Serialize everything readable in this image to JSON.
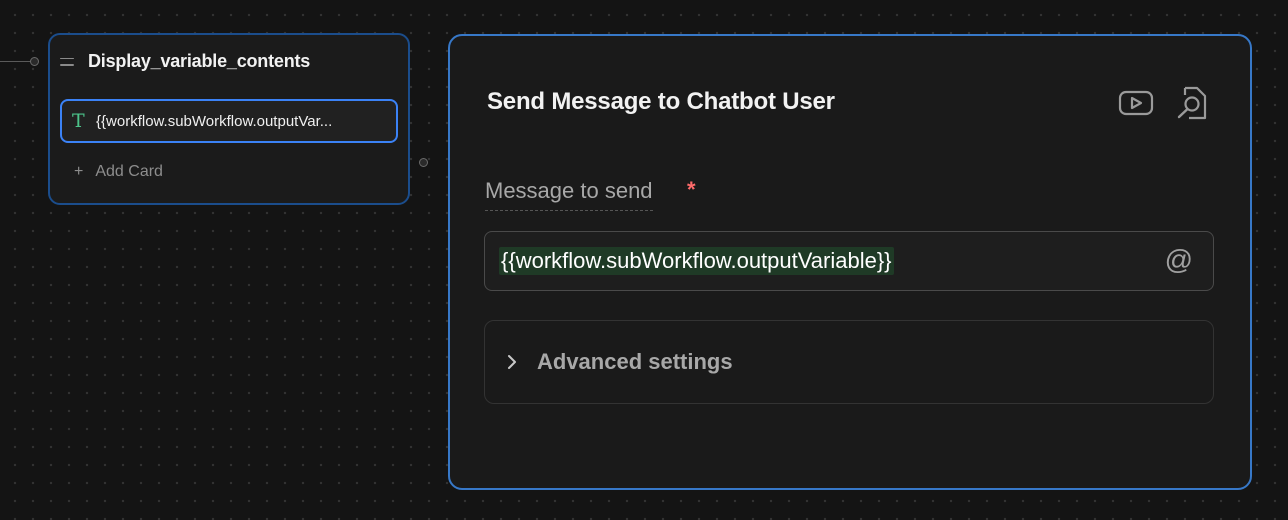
{
  "group_node": {
    "title": "Display_variable_contents",
    "card_text": "{{workflow.subWorkflow.outputVar...",
    "card_icon_glyph": "T",
    "add_card_label": "Add Card"
  },
  "panel": {
    "title": "Send Message to Chatbot User",
    "message_field": {
      "label": "Message to send",
      "required_marker": "*",
      "value": "{{workflow.subWorkflow.outputVariable}}"
    },
    "advanced_label": "Advanced settings"
  },
  "icons": {
    "group_drag": "drag-handle-icon",
    "card_type": "text-type-icon",
    "add": "plus-icon",
    "video": "video-play-icon",
    "search_doc": "document-search-icon",
    "mention": "at-sign-icon",
    "expand": "chevron-right-icon"
  },
  "colors": {
    "selection_blue": "#3b82f6",
    "panel_border": "#3778c8",
    "variable_highlight": "#1f3a26",
    "text_icon_green": "#4cc38a",
    "required_red": "#ff6b6b"
  }
}
